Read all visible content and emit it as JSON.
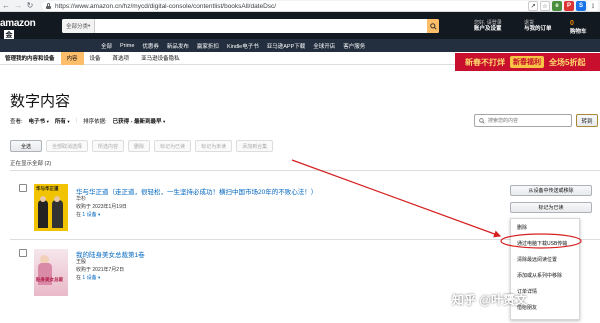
{
  "browser": {
    "url": "https://www.amazon.cn/hz/mycd/digital-console/contentlist/booksAll/dateDsc/",
    "back_icon": "arrow-left",
    "forward_icon": "arrow-right",
    "reload_icon": "reload"
  },
  "header": {
    "logo_text": "amazon",
    "logo_sub": "金",
    "search_department": "全部分类",
    "account_line1": "您好, 请登录",
    "account_line2": "账户及设置",
    "orders_line1": "退货",
    "orders_line2": "与我的订单",
    "cart_count": "0",
    "cart_label": "购物车",
    "nav_links": [
      "全部",
      "Prime",
      "优惠券",
      "新品发布",
      "赢家折扣",
      "Kindle电子书",
      "亚马逊APP下载",
      "全球开店",
      "客户服务"
    ]
  },
  "subnav": {
    "section_label": "管理我的内容和设备",
    "tabs": [
      "内容",
      "设备",
      "首选项",
      "亚马逊设备隐私"
    ],
    "active_tab_index": 0
  },
  "promo": {
    "left": "新春不打烊",
    "middle": "新春福利",
    "right": "全场5折起"
  },
  "page": {
    "title": "数字内容",
    "view_label": "查看:",
    "view_type": "电子书",
    "view_filter": "所有",
    "sort_label": "排序依据:",
    "sort_value": "已获得 - 最新到最早",
    "search_placeholder": "搜索您的内容",
    "go_label": "转到",
    "toolbar_buttons": [
      "全选",
      "全部取消选择",
      "所选内容",
      "删除",
      "标记为已读",
      "标记为未读",
      "添加到合集"
    ],
    "showing_text": "正在显示全部 (2)"
  },
  "items": [
    {
      "title": "华与华正道（走正道，很轻松，一生坚持必成功！横扫中国市场20年的不败心法！）",
      "author": "华杉",
      "acquired": "收购于 2023年1月19日",
      "device_prefix": "在",
      "devices": "1 设备",
      "cover_text": "华与华正道"
    },
    {
      "title": "我的陆身美女总裁第1卷",
      "author": "王殷",
      "acquired": "收购于 2021年7月2日",
      "device_prefix": "在",
      "devices": "1 设备",
      "cover_text": "贴身美女总裁"
    }
  ],
  "row_actions": {
    "manage": "从设备中传送或移除",
    "mark": "标记为已读",
    "more": "..."
  },
  "dropdown": {
    "items": [
      "删除",
      "通过电脑下载USB传输",
      "清除最远阅读位置",
      "添加或从系列中移除",
      "订单详情",
      "借给朋友"
    ],
    "highlighted_index": 1
  },
  "annotation": {
    "color": "#d62020"
  },
  "watermark": "知乎 @叶赟文"
}
